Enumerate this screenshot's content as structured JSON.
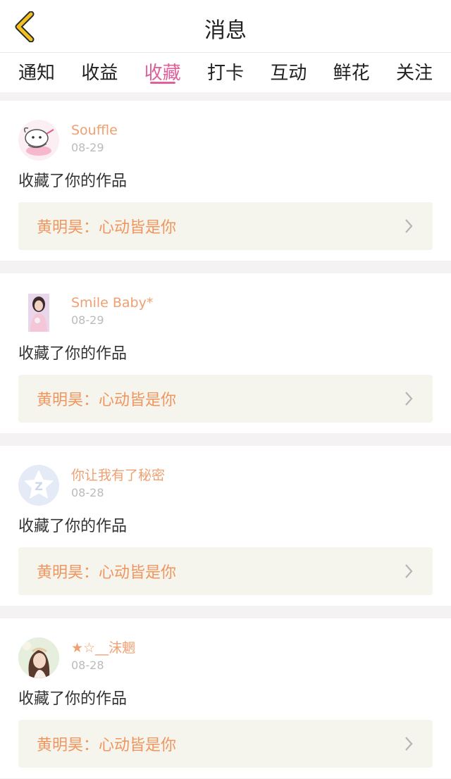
{
  "header": {
    "title": "消息"
  },
  "tabs": [
    {
      "label": "通知"
    },
    {
      "label": "收益"
    },
    {
      "label": "收藏"
    },
    {
      "label": "打卡"
    },
    {
      "label": "互动"
    },
    {
      "label": "鲜花"
    },
    {
      "label": "关注"
    }
  ],
  "active_tab": "收藏",
  "colors": {
    "accent": "#e0609b",
    "username": "#f0a070",
    "work": "#f0955e",
    "back": "#f2c11f"
  },
  "items": [
    {
      "username": "Souffle",
      "date": "08-29",
      "action": "收藏了你的作品",
      "work": "黄明昊：心动皆是你"
    },
    {
      "username": "Smile Baby*",
      "date": "08-29",
      "action": "收藏了你的作品",
      "work": "黄明昊：心动皆是你"
    },
    {
      "username": "你让我有了秘密",
      "date": "08-28",
      "action": "收藏了你的作品",
      "work": "黄明昊：心动皆是你"
    },
    {
      "username": "★☆__沫魍",
      "date": "08-28",
      "action": "收藏了你的作品",
      "work": "黄明昊：心动皆是你"
    }
  ]
}
